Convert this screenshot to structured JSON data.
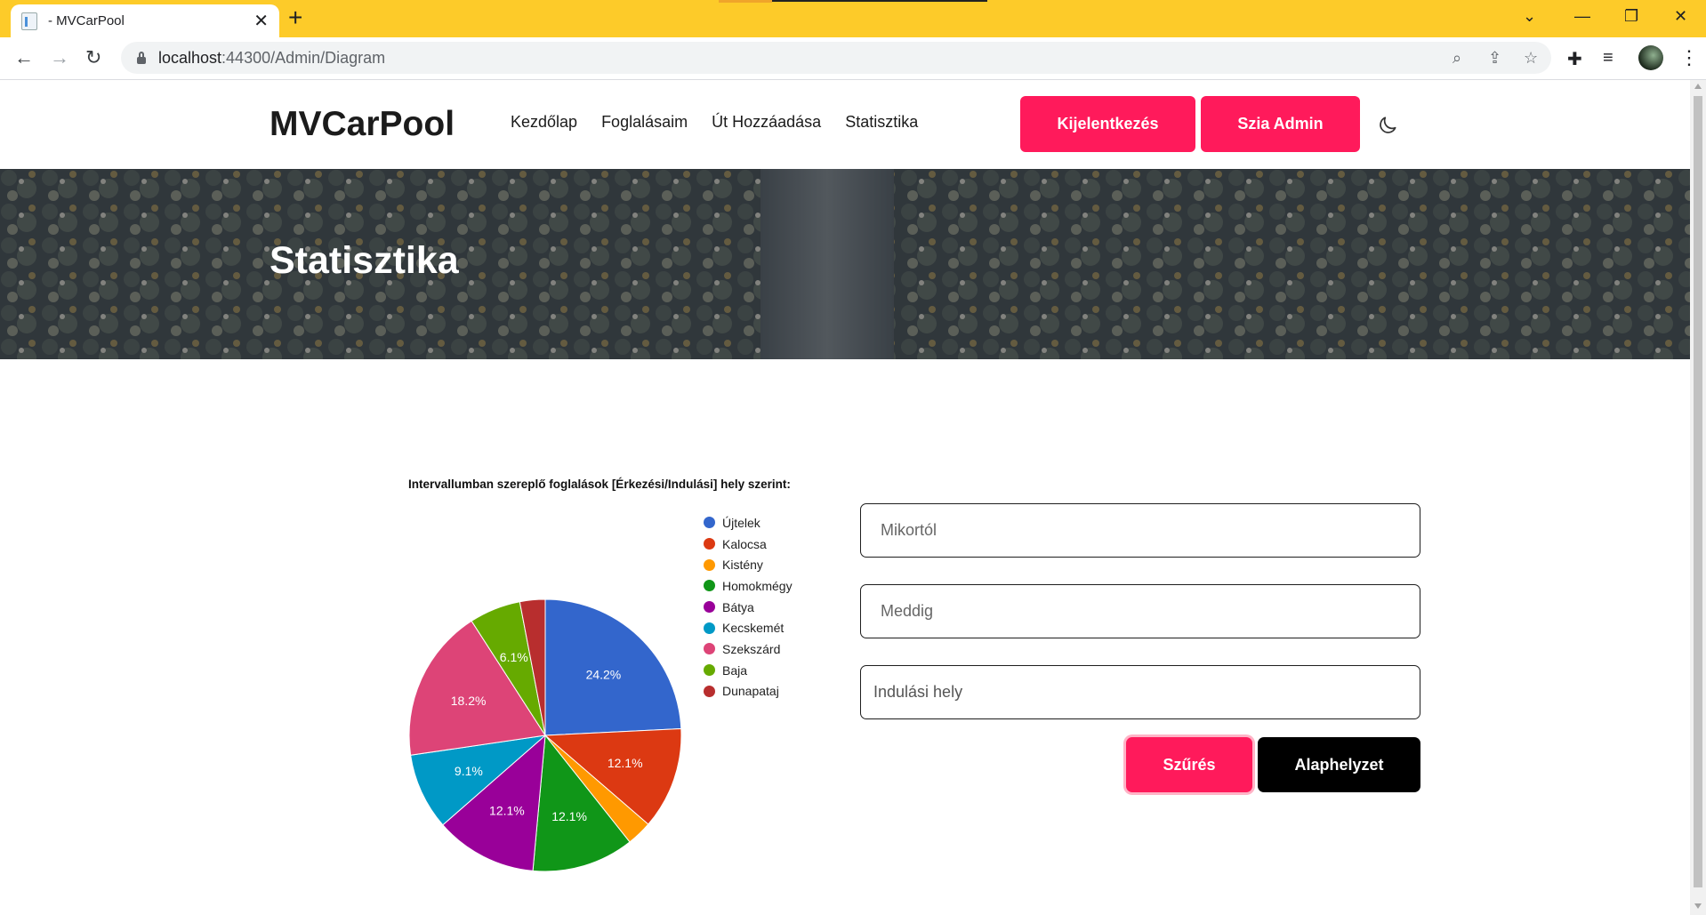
{
  "browser": {
    "tab_title": "- MVCarPool",
    "tab_close": "✕",
    "new_tab": "+",
    "url_host": "localhost",
    "url_rest": ":44300/Admin/Diagram",
    "window_controls": [
      "⌄",
      "—",
      "❐",
      "✕"
    ]
  },
  "navbar": {
    "brand": "MVCarPool",
    "links": [
      "Kezdőlap",
      "Foglalásaim",
      "Út Hozzáadása",
      "Statisztika"
    ],
    "logout_label": "Kijelentkezés",
    "greeting_label": "Szia Admin"
  },
  "hero": {
    "title": "Statisztika"
  },
  "form": {
    "from_placeholder": "Mikortól",
    "to_placeholder": "Meddig",
    "departure_placeholder": "Indulási hely",
    "filter_label": "Szűrés",
    "reset_label": "Alaphelyzet"
  },
  "colors": {
    "accent": "#ff1a5b",
    "chrome": "#fdcb29"
  },
  "chart_data": {
    "type": "pie",
    "title": "Intervallumban szereplő foglalások [Érkezési/Indulási] hely szerint:",
    "categories": [
      "Újtelek",
      "Kalocsa",
      "Kistény",
      "Homokmégy",
      "Bátya",
      "Kecskemét",
      "Szekszárd",
      "Baja",
      "Dunapataj"
    ],
    "values": [
      24.2,
      12.1,
      3.0,
      12.1,
      12.1,
      9.1,
      18.2,
      6.1,
      3.0
    ],
    "labels": [
      "24.2%",
      "12.1%",
      "",
      "12.1%",
      "12.1%",
      "9.1%",
      "18.2%",
      "6.1%",
      ""
    ],
    "colors": [
      "#3366cc",
      "#dc3912",
      "#ff9900",
      "#109618",
      "#990099",
      "#0099c6",
      "#dd4477",
      "#66aa00",
      "#b82e2e"
    ],
    "legend": "right"
  }
}
